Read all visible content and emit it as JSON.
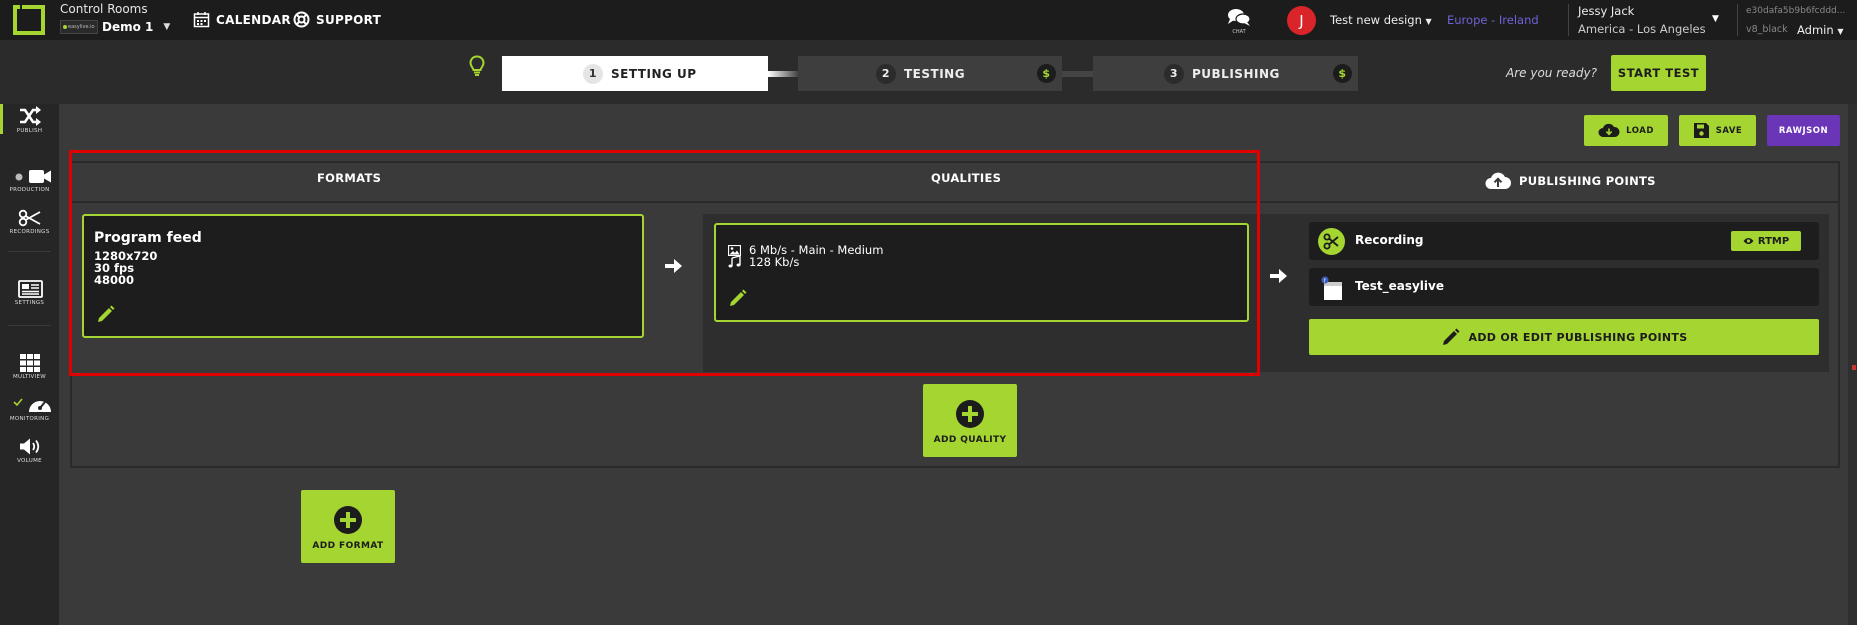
{
  "topbar": {
    "control_rooms_label": "Control Rooms",
    "room_badge": "easylive.io",
    "room_name": "Demo 1",
    "calendar_label": "CALENDAR",
    "support_label": "SUPPORT",
    "chat_label": "CHAT",
    "avatar_initial": "J",
    "design_label": "Test new design",
    "region_label": "Europe - Ireland",
    "user_name": "Jessy Jack",
    "user_timezone": "America - Los Angeles",
    "hash": "e30dafa5b9b6fcddd...",
    "theme": "v8_black",
    "role": "Admin"
  },
  "steps": [
    {
      "num": "1",
      "label": "SETTING UP",
      "state": "active"
    },
    {
      "num": "2",
      "label": "TESTING",
      "state": "idle",
      "badge": "$"
    },
    {
      "num": "3",
      "label": "PUBLISHING",
      "state": "idle",
      "badge": "$"
    }
  ],
  "ready_text": "Are you ready?",
  "start_test_label": "START TEST",
  "sidebar": [
    {
      "label": "PUBLISH",
      "icon": "shuffle-icon"
    },
    {
      "label": "PRODUCTION",
      "icon": "video-camera-icon"
    },
    {
      "label": "RECORDINGS",
      "icon": "scissors-icon"
    },
    {
      "label": "SETTINGS",
      "icon": "newspaper-icon"
    },
    {
      "label": "MULTIVIEW",
      "icon": "grid-icon"
    },
    {
      "label": "MONITORING",
      "icon": "gauge-icon"
    },
    {
      "label": "VOLUME",
      "icon": "speaker-icon"
    }
  ],
  "actions": {
    "load_label": "LOAD",
    "save_label": "SAVE",
    "rawjson_label": "RAWJSON"
  },
  "columns": {
    "formats": "FORMATS",
    "qualities": "QUALITIES",
    "publishing_points": "PUBLISHING POINTS"
  },
  "format": {
    "name": "Program feed",
    "resolution": "1280x720",
    "fps": "30 fps",
    "audio_rate": "48000"
  },
  "quality": {
    "video": "6 Mb/s  -  Main  -  Medium",
    "audio": "128 Kb/s"
  },
  "publishing_points": [
    {
      "name": "Recording",
      "icon": "scissors-icon",
      "badge": "RTMP"
    },
    {
      "name": "Test_easylive",
      "icon": "facebook-page-icon"
    }
  ],
  "add_edit_label": "ADD OR EDIT PUBLISHING POINTS",
  "add_quality_label": "ADD QUALITY",
  "add_format_label": "ADD FORMAT",
  "colors": {
    "accent": "#a4d531",
    "purple": "#6b35b8",
    "avatar": "#d9252a",
    "highlight": "#e00000"
  }
}
